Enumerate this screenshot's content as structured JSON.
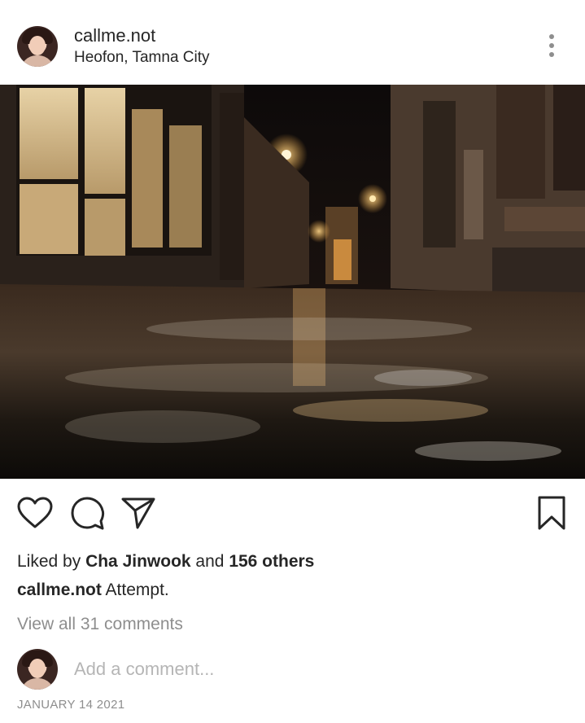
{
  "post": {
    "author": {
      "username": "callme.not",
      "location": "Heofon, Tamna City"
    },
    "photo": {
      "description_icon": "photo"
    },
    "actions": {
      "like_icon": "heart-icon",
      "comment_icon": "comment-icon",
      "share_icon": "send-icon",
      "save_icon": "bookmark-icon"
    },
    "likes": {
      "prefix": "Liked by ",
      "user": "Cha Jinwook",
      "middle": " and ",
      "others": "156 others"
    },
    "caption": {
      "username": "callme.not",
      "text": " Attempt."
    },
    "view_comments": "View all 31 comments",
    "add_comment_placeholder": "Add a comment...",
    "date": "JANUARY 14 2021"
  },
  "colors": {
    "text": "#262626",
    "secondary": "#8e8e8e",
    "placeholder": "#b5b5b5",
    "background": "#ffffff"
  }
}
